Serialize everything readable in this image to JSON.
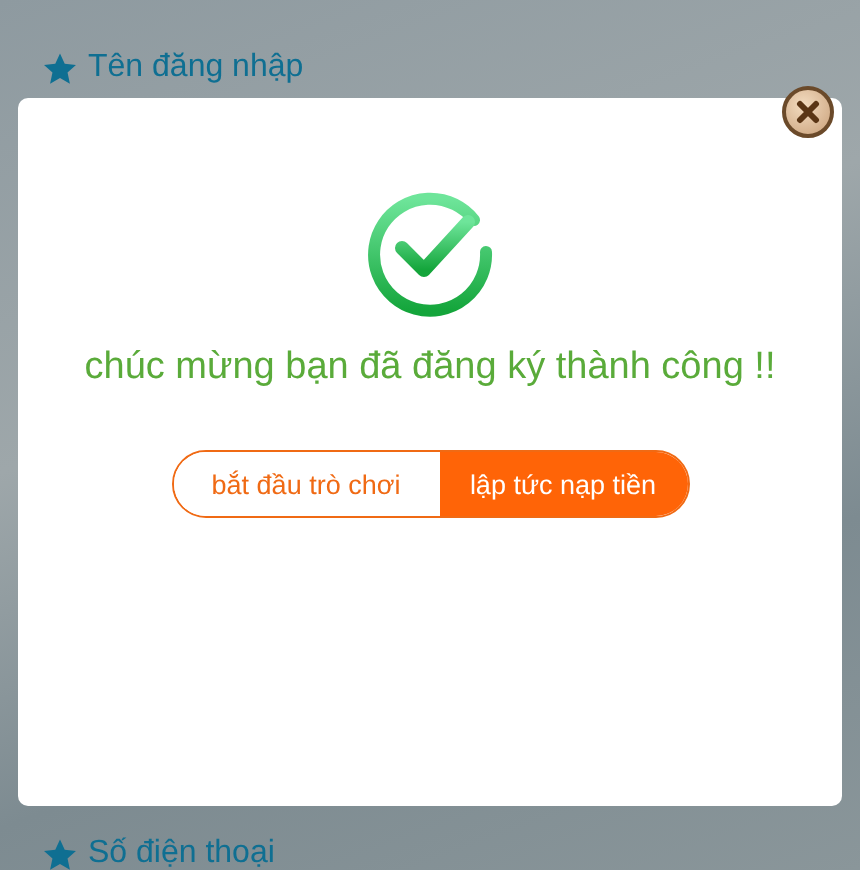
{
  "background_form": {
    "fields": [
      {
        "label": "Tên đăng nhập"
      },
      {
        "label": "Số điện thoại"
      }
    ]
  },
  "dialog": {
    "message": "chúc mừng bạn đã đăng ký thành công !!",
    "buttons": [
      {
        "label": "bắt đầu trò chơi",
        "kind": "outline"
      },
      {
        "label": "lập tức nạp tiền",
        "kind": "filled"
      }
    ]
  }
}
